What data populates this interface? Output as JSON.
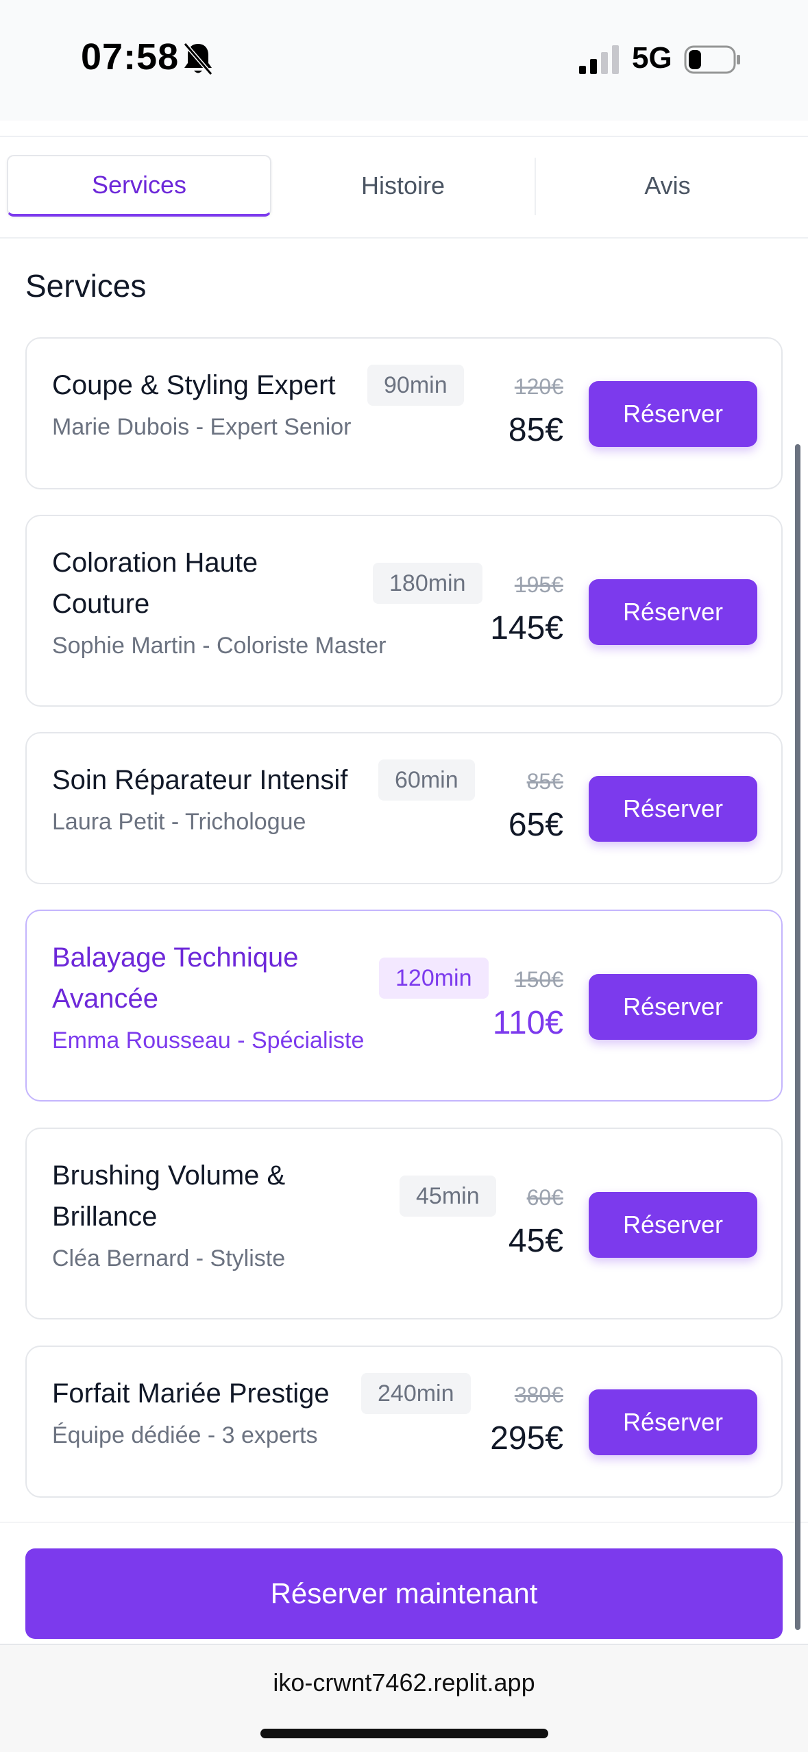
{
  "status_bar": {
    "time": "07:58",
    "network": "5G"
  },
  "tabs": [
    {
      "label": "Services",
      "active": true
    },
    {
      "label": "Histoire",
      "active": false
    },
    {
      "label": "Avis",
      "active": false
    }
  ],
  "section_title": "Services",
  "services": [
    {
      "name": "Coupe & Styling Expert",
      "staff": "Marie Dubois - Expert Senior",
      "duration": "90min",
      "old_price": "120€",
      "price": "85€",
      "button": "Réserver"
    },
    {
      "name": "Coloration Haute Couture",
      "staff": "Sophie Martin - Coloriste Master",
      "duration": "180min",
      "old_price": "195€",
      "price": "145€",
      "button": "Réserver"
    },
    {
      "name": "Soin Réparateur Intensif",
      "staff": "Laura Petit - Trichologue",
      "duration": "60min",
      "old_price": "85€",
      "price": "65€",
      "button": "Réserver"
    },
    {
      "name": "Balayage Technique Avancée",
      "staff": "Emma Rousseau - Spécialiste",
      "duration": "120min",
      "old_price": "150€",
      "price": "110€",
      "button": "Réserver"
    },
    {
      "name": "Brushing Volume & Brillance",
      "staff": "Cléa Bernard - Styliste",
      "duration": "45min",
      "old_price": "60€",
      "price": "45€",
      "button": "Réserver"
    },
    {
      "name": "Forfait Mariée Prestige",
      "staff": "Équipe dédiée - 3 experts",
      "duration": "240min",
      "old_price": "380€",
      "price": "295€",
      "button": "Réserver"
    }
  ],
  "cta_label": "Réserver maintenant",
  "browser": {
    "url": "iko-crwnt7462.replit.app"
  },
  "colors": {
    "accent": "#7c3aed",
    "highlight_border": "#c4b5fd",
    "badge_bg": "#f3f4f6"
  }
}
